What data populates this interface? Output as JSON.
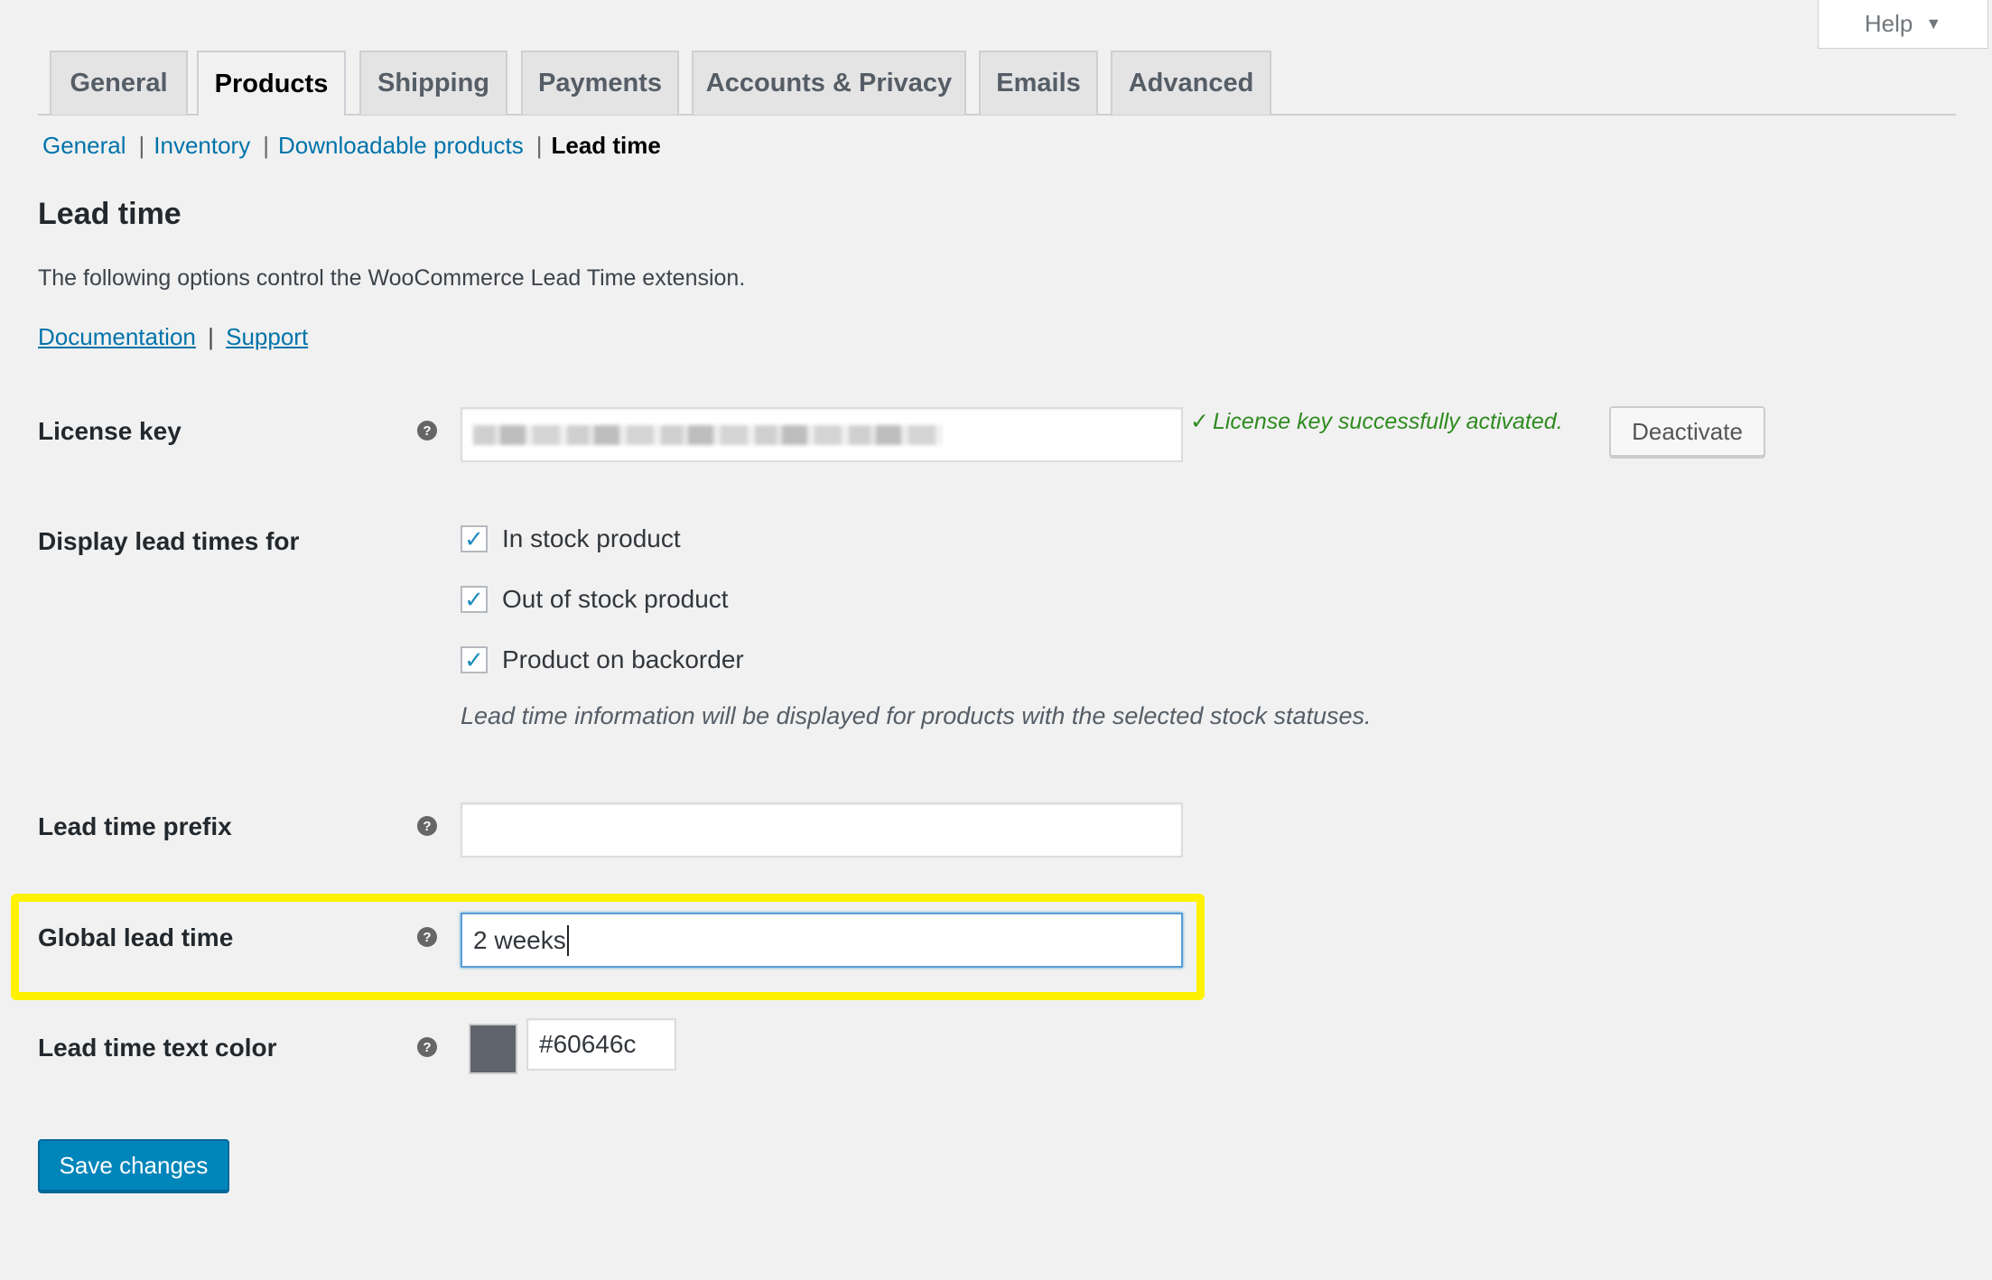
{
  "help": {
    "label": "Help"
  },
  "tabs": [
    {
      "label": "General",
      "active": false
    },
    {
      "label": "Products",
      "active": true
    },
    {
      "label": "Shipping",
      "active": false
    },
    {
      "label": "Payments",
      "active": false
    },
    {
      "label": "Accounts & Privacy",
      "active": false
    },
    {
      "label": "Emails",
      "active": false
    },
    {
      "label": "Advanced",
      "active": false
    }
  ],
  "subnav": {
    "general": "General",
    "inventory": "Inventory",
    "downloadable": "Downloadable products",
    "current": "Lead time",
    "separator": "|"
  },
  "section": {
    "title": "Lead time",
    "description": "The following options control the WooCommerce Lead Time extension.",
    "doc_link": "Documentation",
    "support_link": "Support",
    "link_separator": "|"
  },
  "fields": {
    "license": {
      "label": "License key",
      "status": "License key successfully activated.",
      "status_color": "#2e8b1f",
      "deactivate_label": "Deactivate"
    },
    "display_for": {
      "label": "Display lead times for",
      "options": [
        {
          "label": "In stock product",
          "checked": true
        },
        {
          "label": "Out of stock product",
          "checked": true
        },
        {
          "label": "Product on backorder",
          "checked": true
        }
      ],
      "hint": "Lead time information will be displayed for products with the selected stock statuses."
    },
    "prefix": {
      "label": "Lead time prefix",
      "value": ""
    },
    "global": {
      "label": "Global lead time",
      "value": "2 weeks",
      "highlight_color": "#fff200"
    },
    "text_color": {
      "label": "Lead time text color",
      "value": "#60646c"
    }
  },
  "save_label": "Save changes",
  "colors": {
    "accent": "#0085ba",
    "link": "#0073aa"
  }
}
